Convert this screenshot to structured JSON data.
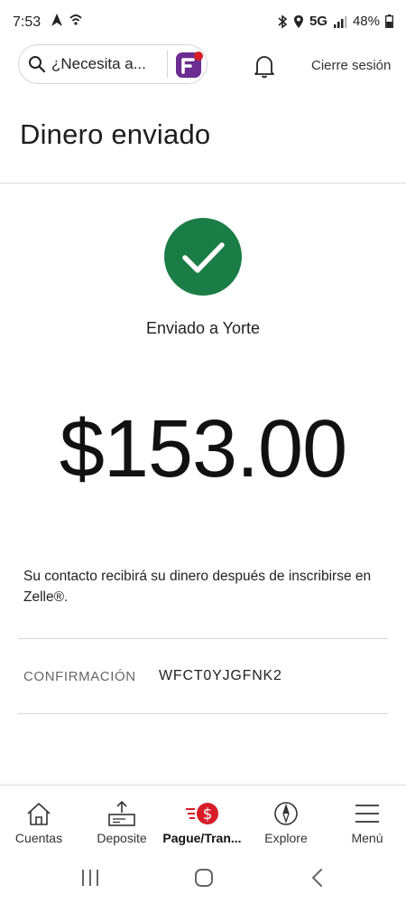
{
  "status_bar": {
    "time": "7:53",
    "network": "5G",
    "battery": "48%"
  },
  "header": {
    "search_placeholder": "¿Necesita a...",
    "logout": "Cierre sesión"
  },
  "page": {
    "title": "Dinero enviado"
  },
  "result": {
    "sent_to": "Enviado a Yorte",
    "amount": "$153.00",
    "note": "Su contacto recibirá su dinero después de inscribirse en Zelle®.",
    "confirmation_label": "CONFIRMACIÓN",
    "confirmation_code": "WFCT0YJGFNK2"
  },
  "bottom_nav": {
    "items": [
      {
        "label": "Cuentas",
        "icon": "house-icon"
      },
      {
        "label": "Deposite",
        "icon": "deposit-icon"
      },
      {
        "label": "Pague/Tran...",
        "icon": "pay-transfer-icon",
        "active": true
      },
      {
        "label": "Explore",
        "icon": "compass-icon"
      },
      {
        "label": "Menú",
        "icon": "menu-icon"
      }
    ]
  },
  "colors": {
    "success": "#1b7d46",
    "assistant_purple": "#6b2c91",
    "accent_red": "#d71e28"
  }
}
